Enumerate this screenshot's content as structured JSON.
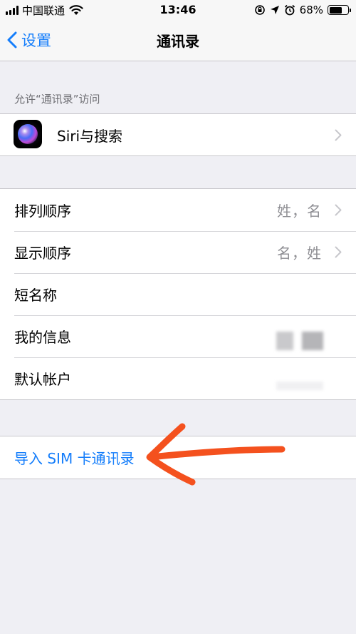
{
  "status_bar": {
    "carrier": "中国联通",
    "time": "13:46",
    "battery_percent": "68%",
    "battery_level": 0.68
  },
  "nav": {
    "back_label": "设置",
    "title": "通讯录"
  },
  "section_header": "允许“通讯录”访问",
  "siri_row": {
    "label": "Siri与搜索"
  },
  "settings_rows": [
    {
      "label": "排列顺序",
      "value": "姓，名"
    },
    {
      "label": "显示顺序",
      "value": "名，姓"
    },
    {
      "label": "短名称",
      "value": ""
    },
    {
      "label": "我的信息",
      "value": ""
    },
    {
      "label": "默认帐户",
      "value": ""
    }
  ],
  "import_row": {
    "label": "导入 SIM 卡通讯录"
  },
  "colors": {
    "accent": "#157efb",
    "annotation": "#f4511e",
    "background": "#efeff4"
  },
  "icons": [
    "signal-icon",
    "wifi-icon",
    "lock-rotation-icon",
    "location-icon",
    "alarm-icon",
    "battery-icon",
    "back-chevron-icon",
    "siri-icon",
    "chevron-right-icon"
  ]
}
